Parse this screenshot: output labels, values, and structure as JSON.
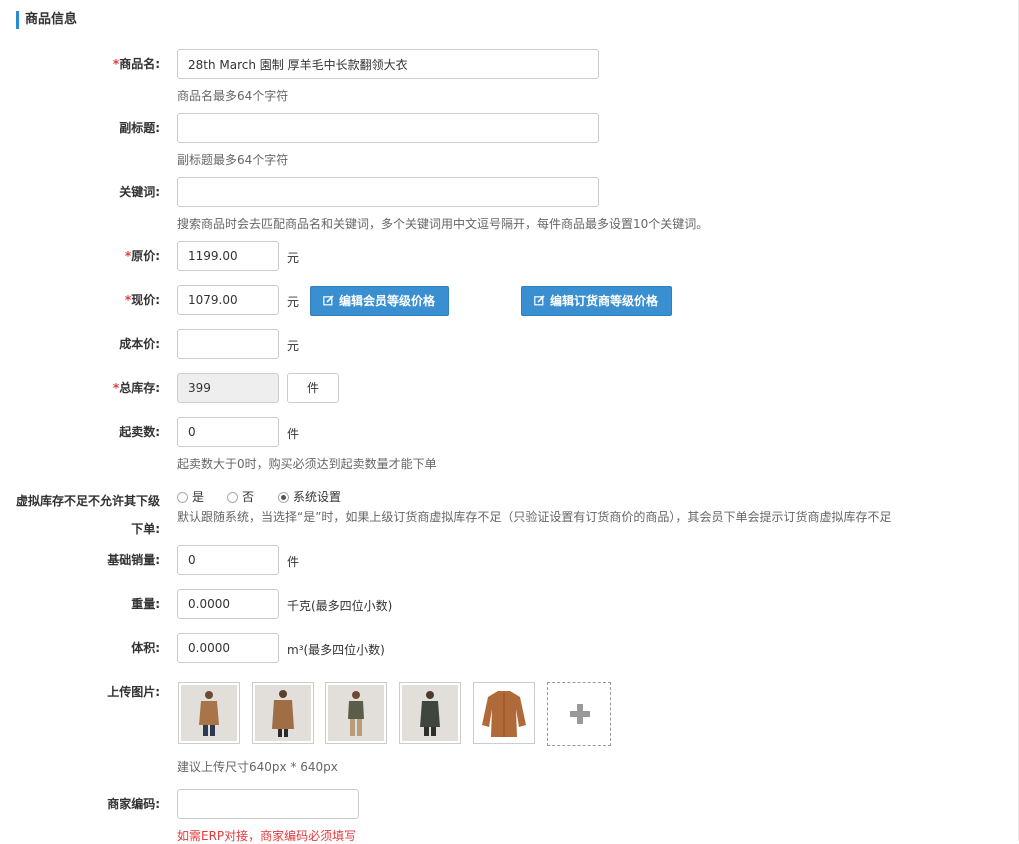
{
  "section": {
    "title": "商品信息"
  },
  "required_mark": "*",
  "product_name": {
    "label": "商品名:",
    "value": "28th March 園制 厚羊毛中长款翻领大衣",
    "hint": "商品名最多64个字符"
  },
  "subtitle": {
    "label": "副标题:",
    "value": "",
    "hint": "副标题最多64个字符"
  },
  "keywords": {
    "label": "关键词:",
    "value": "",
    "hint": "搜索商品时会去匹配商品名和关键词，多个关键词用中文逗号隔开，每件商品最多设置10个关键词。"
  },
  "original_price": {
    "label": "原价:",
    "value": "1199.00",
    "unit": "元"
  },
  "current_price": {
    "label": "现价:",
    "value": "1079.00",
    "unit": "元",
    "member_price_button": "编辑会员等级价格",
    "dealer_price_button": "编辑订货商等级价格"
  },
  "cost_price": {
    "label": "成本价:",
    "value": "",
    "unit": "元"
  },
  "total_stock": {
    "label": "总库存:",
    "value": "399",
    "unit_button": "件"
  },
  "min_purchase": {
    "label": "起卖数:",
    "value": "0",
    "unit": "件",
    "hint": "起卖数大于0时，购买必须达到起卖数量才能下单"
  },
  "virtual_stock": {
    "label_line1": "虚拟库存不足不允许其下级",
    "label_line2": "下单:",
    "options": [
      "是",
      "否",
      "系统设置"
    ],
    "selected": "系统设置",
    "hint": "默认跟随系统，当选择“是”时，如果上级订货商虚拟库存不足（只验证设置有订货商价的商品），其会员下单会提示订货商虚拟库存不足"
  },
  "base_sales": {
    "label": "基础销量:",
    "value": "0",
    "unit": "件"
  },
  "weight": {
    "label": "重量:",
    "value": "0.0000",
    "unit": "千克(最多四位小数)"
  },
  "volume": {
    "label": "体积:",
    "value": "0.0000",
    "unit": "m³(最多四位小数)"
  },
  "images": {
    "label": "上传图片:",
    "hint": "建议上传尺寸640px * 640px",
    "items": [
      {
        "icon": "model-photo-1"
      },
      {
        "icon": "model-photo-2"
      },
      {
        "icon": "model-photo-3"
      },
      {
        "icon": "model-photo-4"
      },
      {
        "icon": "coat-flat-photo"
      }
    ],
    "add_icon": "plus-icon"
  },
  "merchant_code": {
    "label": "商家编码:",
    "value": "",
    "hint": "如需ERP对接，商家编码必须填写"
  },
  "colors": {
    "accent": "#3a8fd0",
    "required": "#e4393c",
    "section_bar": "#2b8ad6"
  }
}
